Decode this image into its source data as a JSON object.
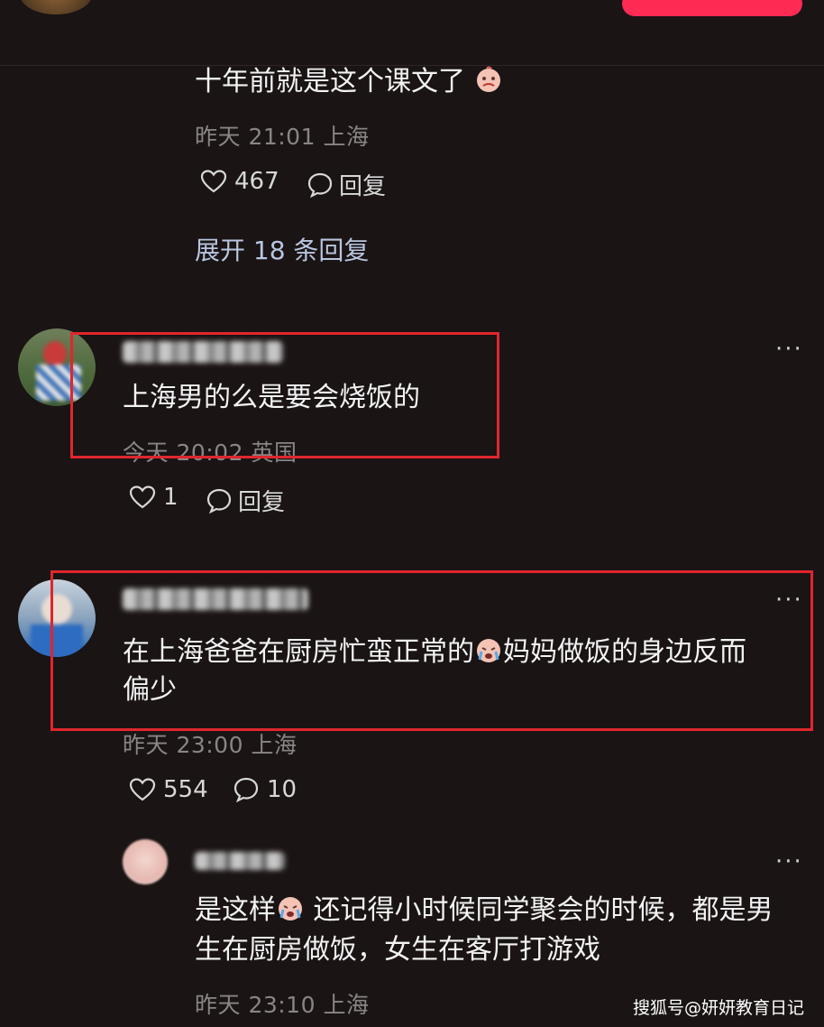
{
  "comments": [
    {
      "text": "十年前就是这个课文了",
      "meta": "昨天 21:01 上海",
      "likes": "467",
      "reply_label": "回复",
      "expand_label": "展开 18 条回复"
    },
    {
      "text": "上海男的么是要会烧饭的",
      "meta": "今天 20:02 英国",
      "likes": "1",
      "reply_label": "回复"
    },
    {
      "text_line1_a": "在上海爸爸在厨房忙蛮正常的",
      "text_line1_b": "妈妈做饭的身边反而",
      "text_line2": "偏少",
      "meta": "昨天 23:00 上海",
      "likes": "554",
      "replies": "10"
    },
    {
      "text_line1_a": "是这样",
      "text_line1_b": " 还记得小时候同学聚会的时候，都是男",
      "text_line2": "生在厨房做饭，女生在客厅打游戏",
      "meta": "昨天 23:10 上海"
    }
  ],
  "more_glyph": "···",
  "watermark": "搜狐号@妍妍教育日记",
  "colors": {
    "highlight_box": "#e0262c",
    "background": "#1a1414",
    "accent": "#ff2b55"
  },
  "icons": [
    "heart-icon",
    "comment-bubble-icon",
    "more-icon",
    "emoji-icon"
  ]
}
